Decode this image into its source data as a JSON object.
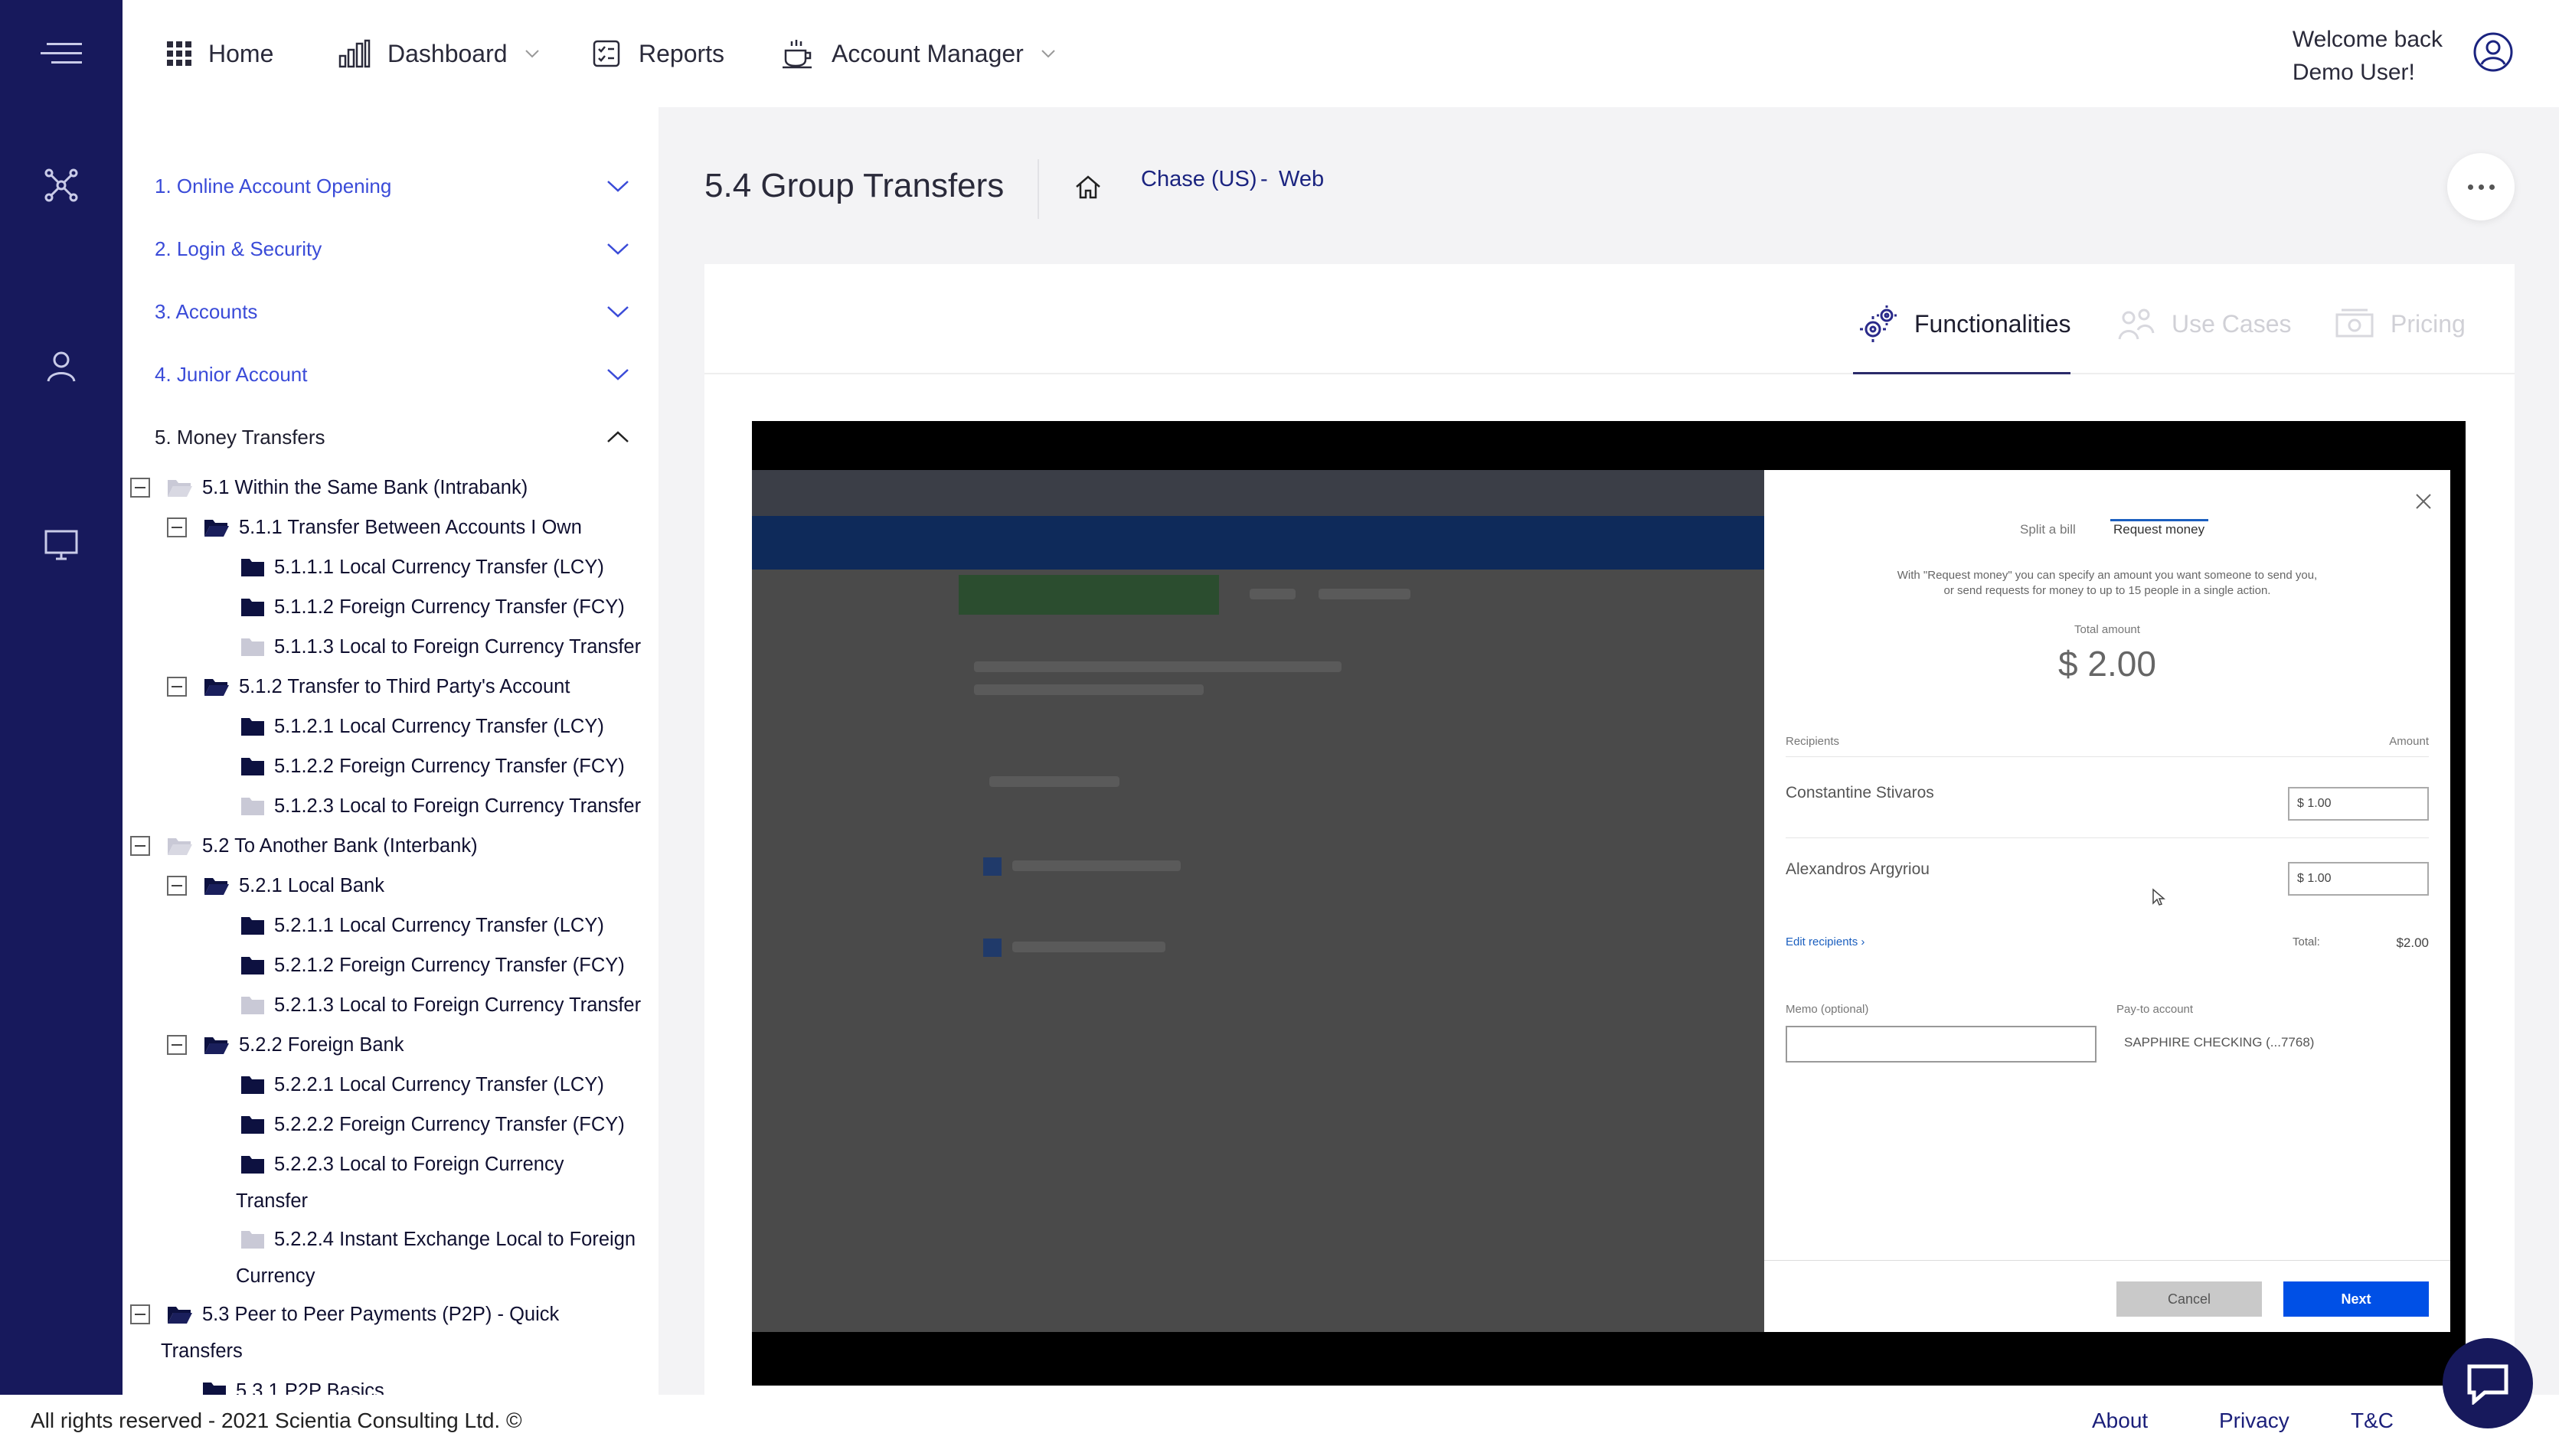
{
  "topnav": {
    "home": "Home",
    "dashboard": "Dashboard",
    "reports": "Reports",
    "account_manager": "Account Manager",
    "welcome_line1": "Welcome back",
    "welcome_line2": "Demo User!"
  },
  "sidebar": {
    "sections": [
      {
        "label": "1. Online Account Opening"
      },
      {
        "label": "2. Login & Security"
      },
      {
        "label": "3. Accounts"
      },
      {
        "label": "4. Junior Account"
      },
      {
        "label": "5. Money Transfers"
      }
    ],
    "tree": {
      "n5_1": "5.1 Within the Same Bank (Intrabank)",
      "n5_1_1": "5.1.1 Transfer Between Accounts I Own",
      "n5_1_1_1": "5.1.1.1 Local Currency Transfer (LCY)",
      "n5_1_1_2": "5.1.1.2 Foreign Currency Transfer (FCY)",
      "n5_1_1_3": "5.1.1.3 Local to Foreign Currency Transfer",
      "n5_1_2": "5.1.2 Transfer to Third Party's Account",
      "n5_1_2_1": "5.1.2.1 Local Currency Transfer (LCY)",
      "n5_1_2_2": "5.1.2.2 Foreign Currency Transfer (FCY)",
      "n5_1_2_3": "5.1.2.3 Local to Foreign Currency Transfer",
      "n5_2": "5.2 To Another Bank (Interbank)",
      "n5_2_1": "5.2.1 Local Bank",
      "n5_2_1_1": "5.2.1.1 Local Currency Transfer (LCY)",
      "n5_2_1_2": "5.2.1.2 Foreign Currency Transfer (FCY)",
      "n5_2_1_3": "5.2.1.3 Local to Foreign Currency Transfer",
      "n5_2_2": "5.2.2 Foreign Bank",
      "n5_2_2_1": "5.2.2.1 Local Currency Transfer (LCY)",
      "n5_2_2_2": "5.2.2.2 Foreign Currency Transfer (FCY)",
      "n5_2_2_3a": "5.2.2.3 Local to Foreign Currency",
      "n5_2_2_3b": "Transfer",
      "n5_2_2_4a": "5.2.2.4 Instant Exchange Local to Foreign",
      "n5_2_2_4b": "Currency",
      "n5_3a": "5.3 Peer to Peer Payments (P2P) - Quick",
      "n5_3b": "Transfers",
      "n5_3_1": "5.3.1 P2P Basics"
    }
  },
  "main": {
    "title": "5.4 Group Transfers",
    "breadcrumb": {
      "bank": "Chase (US)",
      "sep": "-",
      "channel": "Web"
    },
    "tabs": {
      "functionalities": "Functionalities",
      "use_cases": "Use Cases",
      "pricing": "Pricing"
    }
  },
  "modal": {
    "tab_split": "Split a bill",
    "tab_request": "Request money",
    "desc_line1": "With \"Request money\" you can specify an amount you want someone to send you,",
    "desc_line2": "or send requests for money to up to 15 people in a single action.",
    "total_label": "Total amount",
    "total_value": "$  2.00",
    "recipients_header": "Recipients",
    "amount_header": "Amount",
    "recipients": [
      {
        "name": "Constantine Stivaros",
        "amount": "$   1.00"
      },
      {
        "name": "Alexandros Argyriou",
        "amount": "$   1.00"
      }
    ],
    "edit_recipients": "Edit recipients ›",
    "total_small": "Total:",
    "total_small_value": "$2.00",
    "memo_label": "Memo (optional)",
    "payto_label": "Pay-to account",
    "payto_value": "SAPPHIRE CHECKING (...7768)",
    "cancel": "Cancel",
    "next": "Next"
  },
  "footer": {
    "copyright": "All rights reserved - 2021 Scientia Consulting Ltd. ©",
    "about": "About",
    "privacy": "Privacy",
    "tc": "T&C"
  },
  "colors": {
    "rail": "#17195c",
    "link_blue": "#3a4bd8",
    "primary_button": "#0050e6"
  }
}
